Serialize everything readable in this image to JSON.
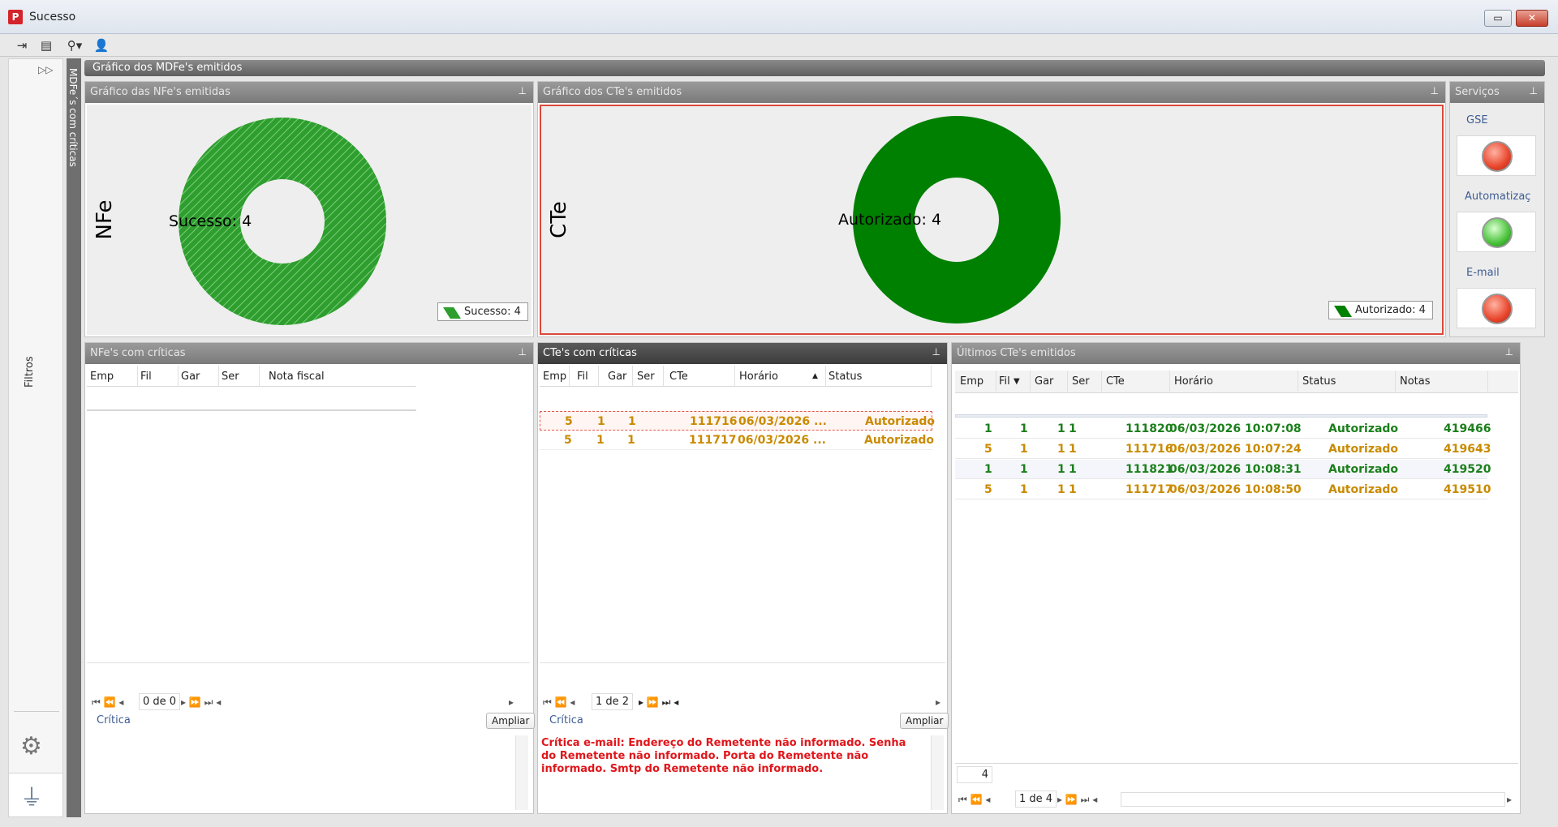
{
  "window": {
    "title": "Sucesso",
    "min_label": "▭",
    "close_label": "✕"
  },
  "toolbar": {
    "icons": [
      "exit-icon",
      "message-icon",
      "search-icon",
      "user-icon"
    ]
  },
  "sidebar": {
    "filtros_label": "Filtros",
    "mdfe_criticas_label": "MDFe´s com críticas"
  },
  "top_header": "Gráfico dos MDFe's emitidos",
  "nfe_chart": {
    "title": "Gráfico das NFe's emitidas",
    "axis_label": "NFe",
    "slice_label": "Sucesso: 4",
    "legend": "Sucesso: 4",
    "color": "#2e9e2e"
  },
  "cte_chart": {
    "title": "Gráfico dos CTe's emitidos",
    "axis_label": "CTe",
    "slice_label": "Autorizado: 4",
    "legend": "Autorizado: 4",
    "color": "#008000"
  },
  "chart_data": [
    {
      "type": "pie",
      "title": "Gráfico das NFe's emitidas",
      "categories": [
        "Sucesso"
      ],
      "values": [
        4
      ],
      "ylabel": "NFe"
    },
    {
      "type": "pie",
      "title": "Gráfico dos CTe's emitidos",
      "categories": [
        "Autorizado"
      ],
      "values": [
        4
      ],
      "ylabel": "CTe"
    }
  ],
  "servicos": {
    "title": "Serviços",
    "items": [
      {
        "label": "GSE",
        "status": "red"
      },
      {
        "label": "Automatizaç",
        "status": "green"
      },
      {
        "label": "E-mail",
        "status": "red"
      }
    ]
  },
  "nfe_criticas": {
    "title": "NFe's com críticas",
    "columns": [
      "Emp",
      "Fil",
      "Gar",
      "Ser",
      "Nota fiscal"
    ],
    "pager": "0 de 0",
    "critica_label": "Crítica",
    "ampliar": "Ampliar"
  },
  "cte_criticas": {
    "title": "CTe's com críticas",
    "columns": [
      "Emp",
      "Fil",
      "Gar",
      "Ser",
      "CTe",
      "Horário",
      "Status"
    ],
    "rows": [
      {
        "emp": "5",
        "fil": "1",
        "gar": "1",
        "cte": "111716",
        "horario": "06/03/2026 ...",
        "status": "Autorizado"
      },
      {
        "emp": "5",
        "fil": "1",
        "gar": "1",
        "cte": "111717",
        "horario": "06/03/2026 ...",
        "status": "Autorizado"
      }
    ],
    "pager": "1 de 2",
    "critica_label": "Crítica",
    "ampliar": "Ampliar",
    "critica_text": "Crítica e-mail: Endereço do Remetente não informado. Senha do Remetente não informado. Porta do Remetente não informado. Smtp do Remetente não informado."
  },
  "ultimos_ctes": {
    "title": "Últimos CTe's emitidos",
    "columns": [
      "Emp",
      "Fil",
      "Gar",
      "Ser",
      "CTe",
      "Horário",
      "Status",
      "Notas"
    ],
    "rows": [
      {
        "emp": "1",
        "fil": "1",
        "gar": "1",
        "ser": "1",
        "cte": "111820",
        "horario": "06/03/2026 10:07:08",
        "status": "Autorizado",
        "notas": "419466",
        "color": "#1b7f1b"
      },
      {
        "emp": "5",
        "fil": "1",
        "gar": "1",
        "ser": "1",
        "cte": "111716",
        "horario": "06/03/2026 10:07:24",
        "status": "Autorizado",
        "notas": "419643",
        "color": "#c98a00"
      },
      {
        "emp": "1",
        "fil": "1",
        "gar": "1",
        "ser": "1",
        "cte": "111821",
        "horario": "06/03/2026 10:08:31",
        "status": "Autorizado",
        "notas": "419520",
        "color": "#1b7f1b"
      },
      {
        "emp": "5",
        "fil": "1",
        "gar": "1",
        "ser": "1",
        "cte": "111717",
        "horario": "06/03/2026 10:08:50",
        "status": "Autorizado",
        "notas": "419510",
        "color": "#c98a00"
      }
    ],
    "count": "4",
    "pager": "1 de 4"
  }
}
